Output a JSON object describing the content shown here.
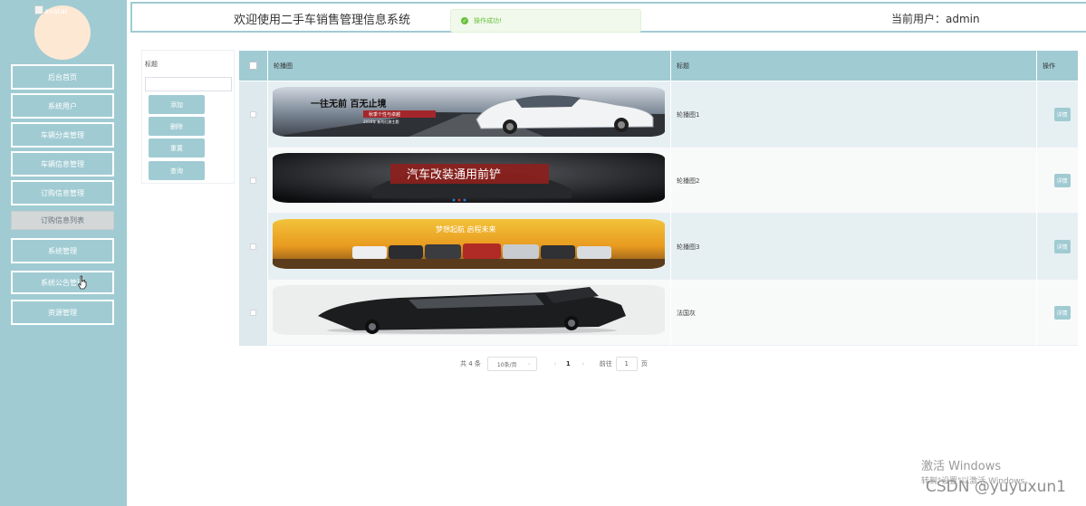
{
  "sidebar": {
    "avatar_alt": "avatar",
    "items": [
      {
        "label": "后台首页"
      },
      {
        "label": "系统用户"
      },
      {
        "label": "车辆分类管理"
      },
      {
        "label": "车辆信息管理"
      },
      {
        "label": "订购信息管理"
      },
      {
        "label": "订购信息列表"
      },
      {
        "label": "系统管理"
      },
      {
        "label": "系统公告管理"
      },
      {
        "label": "资源管理"
      }
    ],
    "active_index": 5
  },
  "header": {
    "title": "欢迎使用二手车销售管理信息系统",
    "user": "当前用户：admin"
  },
  "toast": {
    "message": "操作成功!"
  },
  "search": {
    "label": "标题",
    "input_value": "",
    "buttons": [
      "添加",
      "删除",
      "重置",
      "查询"
    ]
  },
  "table": {
    "columns": [
      "轮播图",
      "标题",
      "操作"
    ],
    "rows": [
      {
        "title": "轮播图1",
        "action": "详情",
        "banner": "一往无前 百无止境 / 秋季个性与卓越 / 2016年 新的红旗主题"
      },
      {
        "title": "轮播图2",
        "action": "详情",
        "banner": "汽车改装通用前铲"
      },
      {
        "title": "轮播图3",
        "action": "详情",
        "banner": "梦想起航 启程未来"
      },
      {
        "title": "法国灰",
        "action": "详情",
        "banner": ""
      }
    ]
  },
  "pagination": {
    "total": "共 4 条",
    "page_size": "10条/页",
    "prev": "‹",
    "current": "1",
    "next": "›",
    "goto_label": "前往",
    "goto_value": "1",
    "page_unit": "页"
  },
  "watermarks": {
    "windows_title": "激活 Windows",
    "windows_sub": "转到\"设置\"以激活 Windows。",
    "csdn": "CSDN @yuyuxun1"
  },
  "colors": {
    "accent": "#a0cbd3",
    "success": "#67c23a"
  }
}
